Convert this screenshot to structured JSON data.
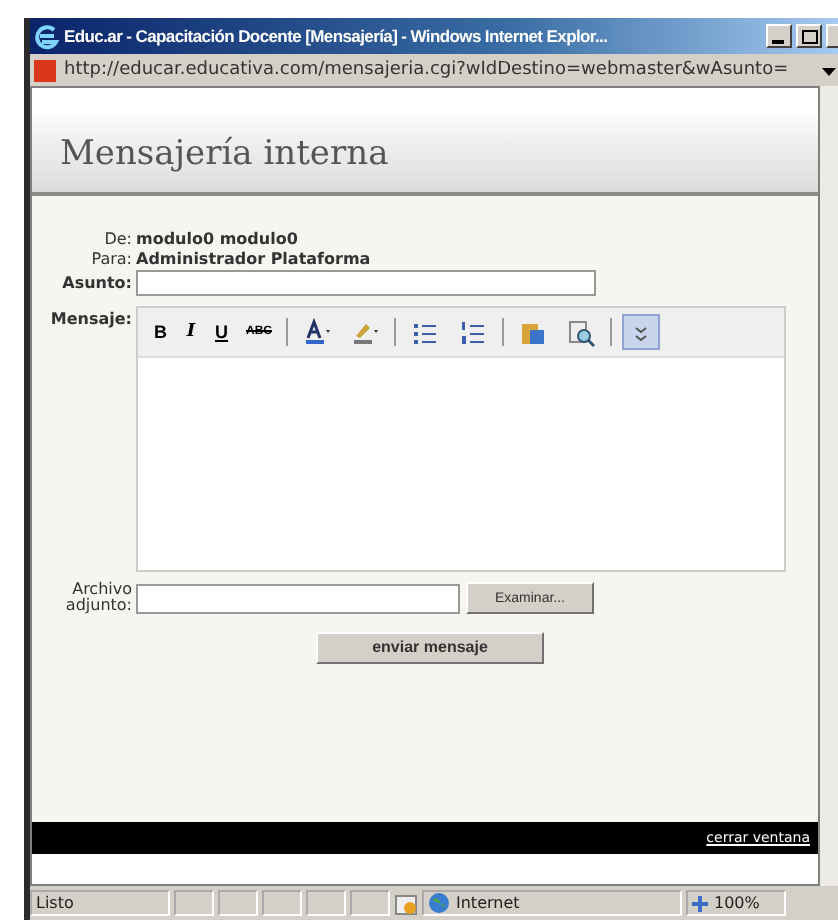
{
  "window": {
    "title": "Educ.ar - Capacitación Docente [Mensajería] - Windows Internet Explor...",
    "address": "http://educar.educativa.com/mensajeria.cgi?wIdDestino=webmaster&wAsunto="
  },
  "page": {
    "heading": "Mensajería interna",
    "from": {
      "label": "De:",
      "value": "modulo0 modulo0"
    },
    "to": {
      "label": "Para:",
      "value": "Administrador Plataforma"
    },
    "subject": {
      "label": "Asunto:"
    },
    "message": {
      "label": "Mensaje:",
      "toolbar": [
        {
          "kind": "bold",
          "label": "B",
          "active": false
        },
        {
          "kind": "italic",
          "label": "I",
          "active": false
        },
        {
          "kind": "underline",
          "label": "U",
          "active": false
        },
        {
          "kind": "strike",
          "label": "ABC",
          "active": false
        },
        {
          "kind": "separator"
        },
        {
          "kind": "font-color",
          "active": false
        },
        {
          "kind": "highlight",
          "active": false
        },
        {
          "kind": "separator"
        },
        {
          "kind": "bullets",
          "active": false
        },
        {
          "kind": "numbers",
          "active": false
        },
        {
          "kind": "separator"
        },
        {
          "kind": "paste",
          "active": false
        },
        {
          "kind": "find",
          "active": false
        },
        {
          "kind": "separator"
        },
        {
          "kind": "more",
          "active": true
        }
      ]
    },
    "attachment": {
      "label": "Archivo adjunto:",
      "browse": "Examinar..."
    },
    "send": "enviar mensaje",
    "close_link": "cerrar ventana"
  },
  "status_bar": {
    "text": "Listo",
    "zone": "Internet",
    "zoom": "100%"
  }
}
